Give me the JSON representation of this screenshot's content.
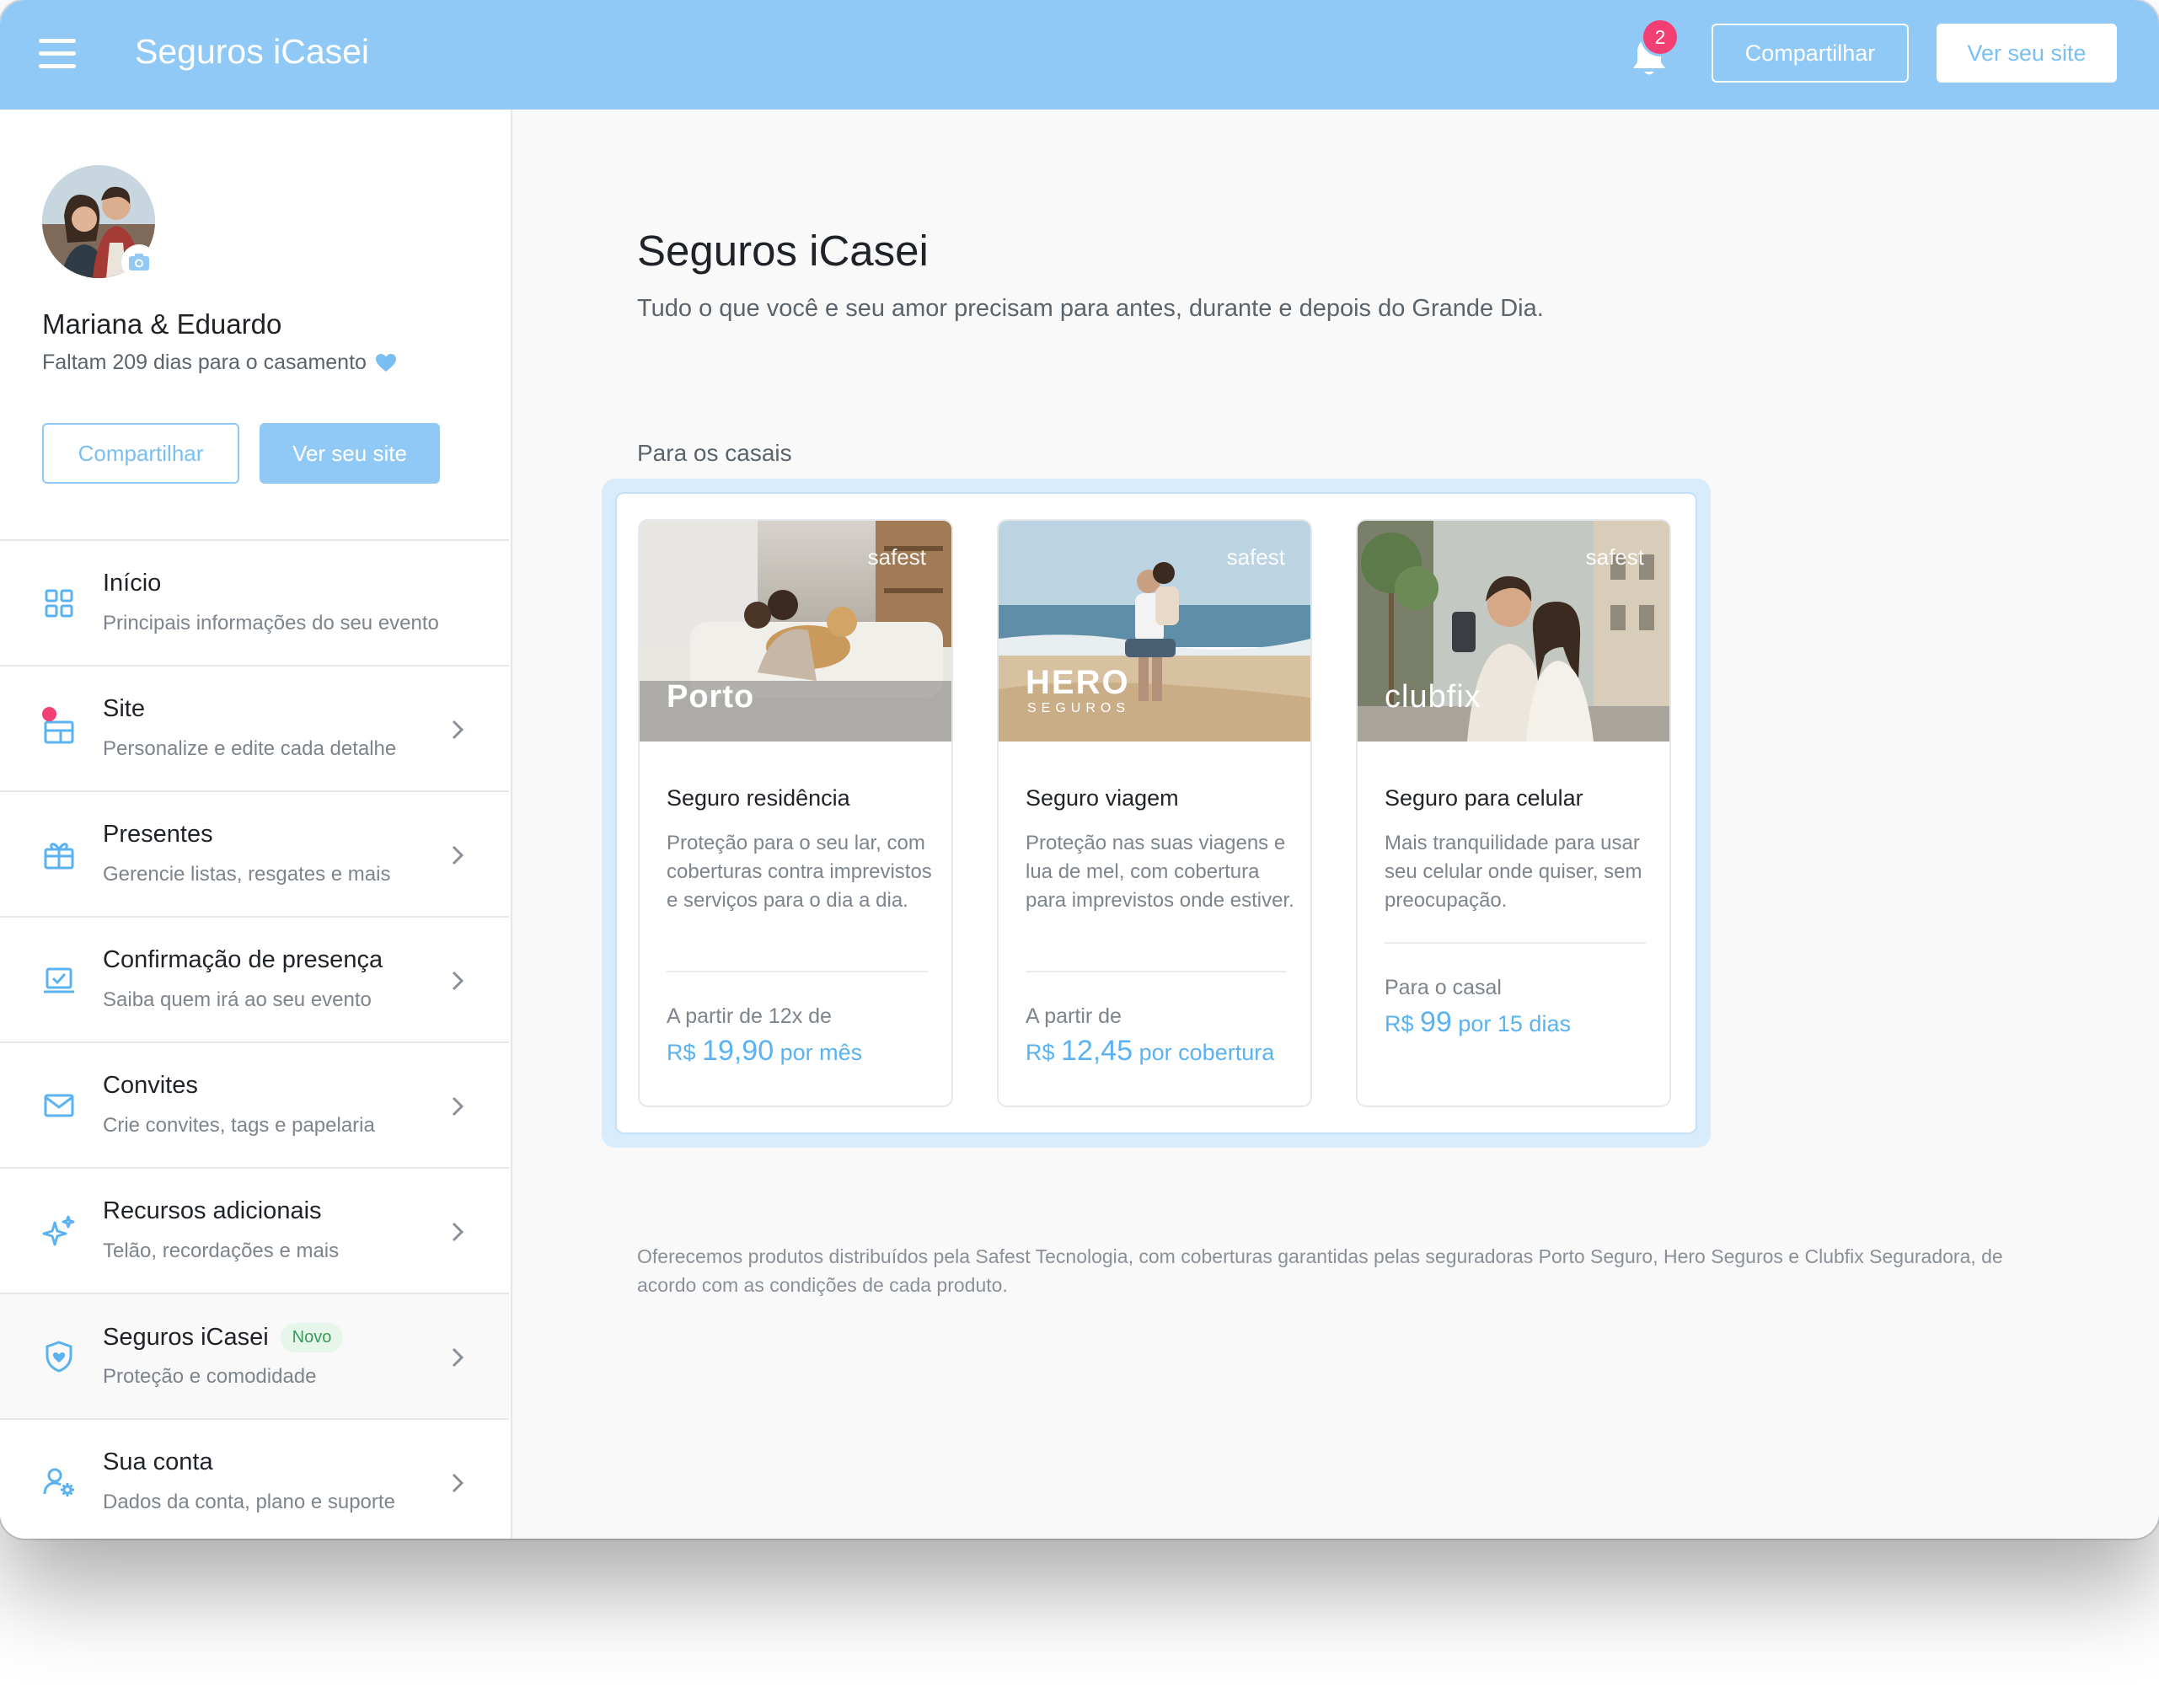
{
  "header": {
    "title": "Seguros iCasei",
    "notification_count": "2",
    "share_label": "Compartilhar",
    "site_label": "Ver seu site"
  },
  "profile": {
    "couple_name": "Mariana & Eduardo",
    "countdown": "Faltam 209 dias para o casamento",
    "share_label": "Compartilhar",
    "site_label": "Ver seu site"
  },
  "nav": [
    {
      "title": "Início",
      "subtitle": "Principais informações do seu evento",
      "icon": "grid-icon"
    },
    {
      "title": "Site",
      "subtitle": "Personalize e edite cada detalhe",
      "icon": "layout-icon"
    },
    {
      "title": "Presentes",
      "subtitle": "Gerencie listas, resgates e mais",
      "icon": "gift-icon"
    },
    {
      "title": "Confirmação de presença",
      "subtitle": "Saiba quem irá ao seu evento",
      "icon": "laptop-check-icon"
    },
    {
      "title": "Convites",
      "subtitle": "Crie convites, tags e papelaria",
      "icon": "envelope-icon"
    },
    {
      "title": "Recursos adicionais",
      "subtitle": "Telão, recordações e mais",
      "icon": "sparkles-icon"
    },
    {
      "title": "Seguros iCasei",
      "subtitle": "Proteção e comodidade",
      "icon": "shield-heart-icon",
      "badge": "Novo"
    },
    {
      "title": "Sua conta",
      "subtitle": "Dados da conta, plano e suporte",
      "icon": "user-gear-icon"
    }
  ],
  "main": {
    "title": "Seguros iCasei",
    "subtitle": "Tudo o que você e seu amor precisam para antes, durante e depois do Grande Dia.",
    "section_label": "Para os casais",
    "cards": [
      {
        "partner_tag": "safest",
        "brand": "Porto",
        "title": "Seguro residência",
        "description": "Proteção para o seu lar, com coberturas contra imprevistos e serviços para o dia a dia.",
        "price_label": "A partir de 12x de",
        "currency": "R$",
        "amount": "19,90",
        "period": "por mês"
      },
      {
        "partner_tag": "safest",
        "brand": "HERO",
        "brand_sub": "SEGUROS",
        "title": "Seguro viagem",
        "description": "Proteção nas suas viagens e lua de mel, com cobertura para imprevistos onde estiver.",
        "price_label": "A partir de",
        "currency": "R$",
        "amount": "12,45",
        "period": "por cobertura"
      },
      {
        "partner_tag": "safest",
        "brand": "clubfix",
        "title": "Seguro para celular",
        "description": "Mais tranquilidade para usar seu celular onde quiser, sem preocupação.",
        "price_label": "Para o casal",
        "currency": "R$",
        "amount": "99",
        "period": "por 15 dias"
      }
    ],
    "disclaimer": "Oferecemos produtos distribuídos pela Safest Tecnologia, com coberturas garantidas pelas seguradoras Porto Seguro, Hero Seguros e Clubfix Seguradora, de acordo com as condições de cada produto."
  },
  "colors": {
    "header_bg": "#90c9f5",
    "accent": "#5bb2f0",
    "badge": "#f33f73",
    "novo_badge_text": "#3b9a57"
  }
}
